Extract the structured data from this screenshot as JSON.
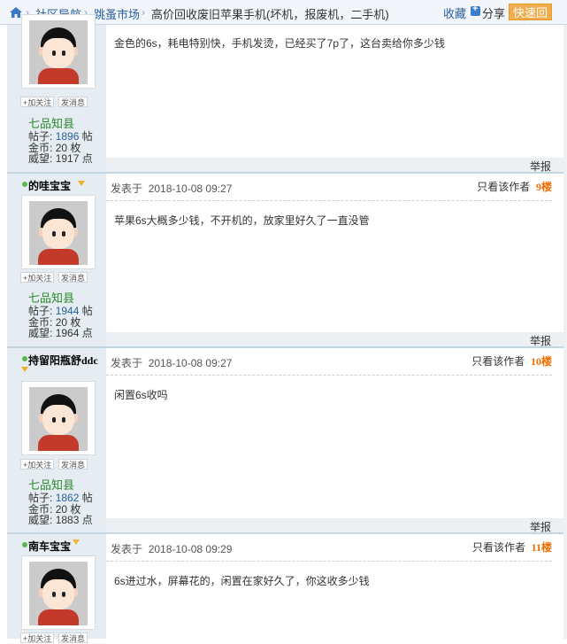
{
  "nav": {
    "crumbs": [
      "社区导航",
      "跳蚤市场"
    ],
    "title": "高价回收废旧苹果手机(坏机，报废机，二手机)",
    "favorite": "收藏",
    "share": "分享",
    "quick_reply": "快速回复"
  },
  "member_buttons": {
    "follow": "+加关注",
    "message": "发消息"
  },
  "labels": {
    "posts": "帖子:",
    "posts_unit": "帖",
    "coins": "金币:",
    "coins_unit": "枚",
    "prestige": "威望:",
    "prestige_unit": "点",
    "posted_at": "发表于",
    "only_author": "只看该作者",
    "report": "举报"
  },
  "posts": [
    {
      "rank": "七品知县",
      "posts": "1896",
      "coins": "20",
      "prestige": "1917",
      "content": "金色的6s，耗电特别快，手机发烫，已经买了7p了，这台卖给你多少钱"
    },
    {
      "username": "的哇宝宝",
      "rank": "七品知县",
      "posts": "1944",
      "coins": "20",
      "prestige": "1964",
      "time": "2018-10-08 09:27",
      "floor": "9楼",
      "content": "苹果6s大概多少钱，不开机的，放家里好久了一直没管"
    },
    {
      "username": "持留阳瓶舒ddc",
      "rank": "七品知县",
      "posts": "1862",
      "coins": "20",
      "prestige": "1883",
      "time": "2018-10-08 09:27",
      "floor": "10楼",
      "content": "闲置6s收吗"
    },
    {
      "username": "南车宝宝",
      "time": "2018-10-08 09:29",
      "floor": "11楼",
      "content": "6s进过水，屏幕花的，闲置在家好久了，你这收多少钱"
    }
  ]
}
